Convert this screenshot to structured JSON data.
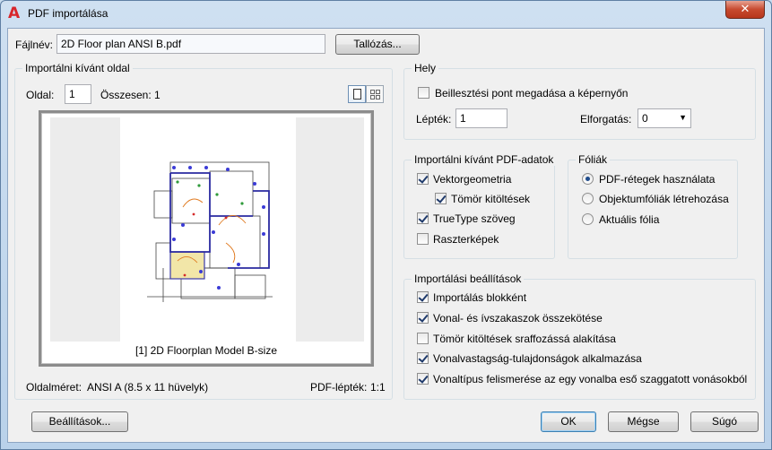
{
  "window": {
    "title": "PDF importálása",
    "close_label": "✕"
  },
  "file": {
    "label": "Fájlnév:",
    "value": "2D Floor plan ANSI B.pdf",
    "browse_label": "Tallózás..."
  },
  "page_group": {
    "title": "Importálni kívánt oldal",
    "page_label": "Oldal:",
    "page_value": "1",
    "total_label": "Összesen:",
    "total_value": "1",
    "thumbnail_caption": "[1] 2D Floorplan Model B-size",
    "page_size_label": "Oldalméret:",
    "page_size_value": "ANSI A (8.5 x 11 hüvelyk)",
    "pdf_scale_label": "PDF-lépték:",
    "pdf_scale_value": "1:1"
  },
  "location_group": {
    "title": "Hely",
    "specify_onscreen": "Beillesztési pont megadása a képernyőn",
    "specify_onscreen_checked": false,
    "scale_label": "Lépték:",
    "scale_value": "1",
    "rotation_label": "Elforgatás:",
    "rotation_value": "0"
  },
  "pdf_data_group": {
    "title": "Importálni kívánt PDF-adatok",
    "items": [
      {
        "label": "Vektorgeometria",
        "checked": true
      },
      {
        "label": "Tömör kitöltések",
        "checked": true
      },
      {
        "label": "TrueType szöveg",
        "checked": true
      },
      {
        "label": "Raszterképek",
        "checked": false
      }
    ]
  },
  "layers_group": {
    "title": "Fóliák",
    "options": [
      {
        "label": "PDF-rétegek használata",
        "selected": true
      },
      {
        "label": "Objektumfóliák létrehozása",
        "selected": false
      },
      {
        "label": "Aktuális fólia",
        "selected": false
      }
    ]
  },
  "import_options_group": {
    "title": "Importálási beállítások",
    "items": [
      {
        "label": "Importálás blokként",
        "checked": true
      },
      {
        "label": "Vonal- és ívszakaszok összekötése",
        "checked": true
      },
      {
        "label": "Tömör kitöltések sraffozássá alakítása",
        "checked": false
      },
      {
        "label": "Vonalvastagság-tulajdonságok alkalmazása",
        "checked": true
      },
      {
        "label": "Vonaltípus felismerése az egy vonalba eső szaggatott vonásokból",
        "checked": true
      }
    ]
  },
  "buttons": {
    "settings": "Beállítások...",
    "ok": "OK",
    "cancel": "Mégse",
    "help": "Súgó"
  },
  "icons": {
    "app": "autocad-logo-icon",
    "single_view": "single-page-view-icon",
    "grid_view": "grid-view-icon"
  }
}
